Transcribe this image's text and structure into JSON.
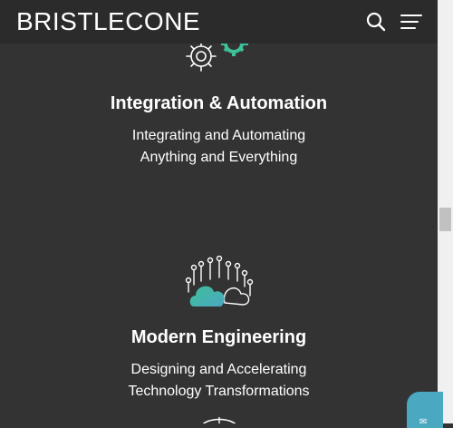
{
  "header": {
    "logo_text": "BRISTLECONE",
    "search_icon": "search-icon",
    "menu_icon": "hamburger-menu-icon"
  },
  "sections": [
    {
      "icon": "gears-icon",
      "title": "Integration & Automation",
      "desc_line1": "Integrating and Automating",
      "desc_line2": "Anything and Everything"
    },
    {
      "icon": "cloud-network-icon",
      "title": "Modern Engineering",
      "desc_line1": "Designing and Accelerating",
      "desc_line2": "Technology Transformations"
    }
  ],
  "chat": {
    "icon": "chat-icon"
  },
  "colors": {
    "background": "#333333",
    "header": "#2b2b2b",
    "accent_teal": "#3fbf9a",
    "accent_blue": "#4aa8c0"
  }
}
